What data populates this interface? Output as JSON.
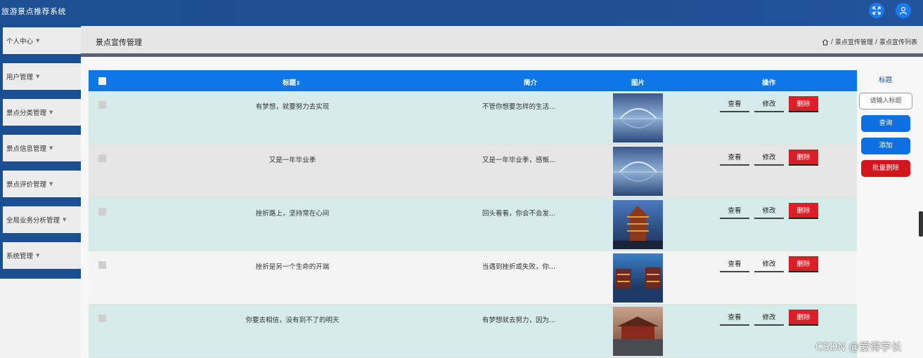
{
  "app": {
    "title": "旅游景点推荐系统"
  },
  "topbar": {
    "icons": [
      "fullscreen-icon",
      "user-icon"
    ],
    "color": "#1d4f95"
  },
  "sidebar": {
    "items": [
      {
        "label": "个人中心"
      },
      {
        "label": "用户管理"
      },
      {
        "label": "景点分类管理"
      },
      {
        "label": "景点信息管理"
      },
      {
        "label": "景点评价管理"
      },
      {
        "label": "全局业务分析管理"
      },
      {
        "label": "系统管理"
      }
    ]
  },
  "header": {
    "title": "景点宣传管理",
    "breadcrumb": [
      "景点宣传管理",
      "景点宣传列表"
    ]
  },
  "table": {
    "columns": {
      "title": "标题",
      "sort_icon": "⇕",
      "intro": "简介",
      "image": "图片",
      "actions": "操作"
    },
    "actions": {
      "view": "查看",
      "edit": "修改",
      "delete": "删除"
    },
    "rows": [
      {
        "title": "有梦想，就要努力去实现",
        "intro": "不管你想要怎样的生活...",
        "image": "bridge-photo",
        "bg": "#d6ebea"
      },
      {
        "title": "又是一年毕业季",
        "intro": "又是一年毕业季，感慨...",
        "image": "bridge-photo",
        "bg": "#e6e6e6"
      },
      {
        "title": "挫折路上，坚持常在心间",
        "intro": "回头看看，你会不会发...",
        "image": "tower-photo",
        "bg": "#d6ebea"
      },
      {
        "title": "挫折是另一个生命的开端",
        "intro": "当遇到挫折或失败，你...",
        "image": "river-night-photo",
        "bg": "#f4f4f4"
      },
      {
        "title": "你要去相信，没有到不了的明天",
        "intro": "有梦想就去努力，因为...",
        "image": "temple-photo",
        "bg": "#d6ebea"
      }
    ]
  },
  "search": {
    "label": "标题",
    "placeholder": "请输入标题",
    "query_label": "查询",
    "add_label": "添加",
    "batch_delete_label": "批量删除"
  },
  "watermark": "CSDN @爱得学长"
}
